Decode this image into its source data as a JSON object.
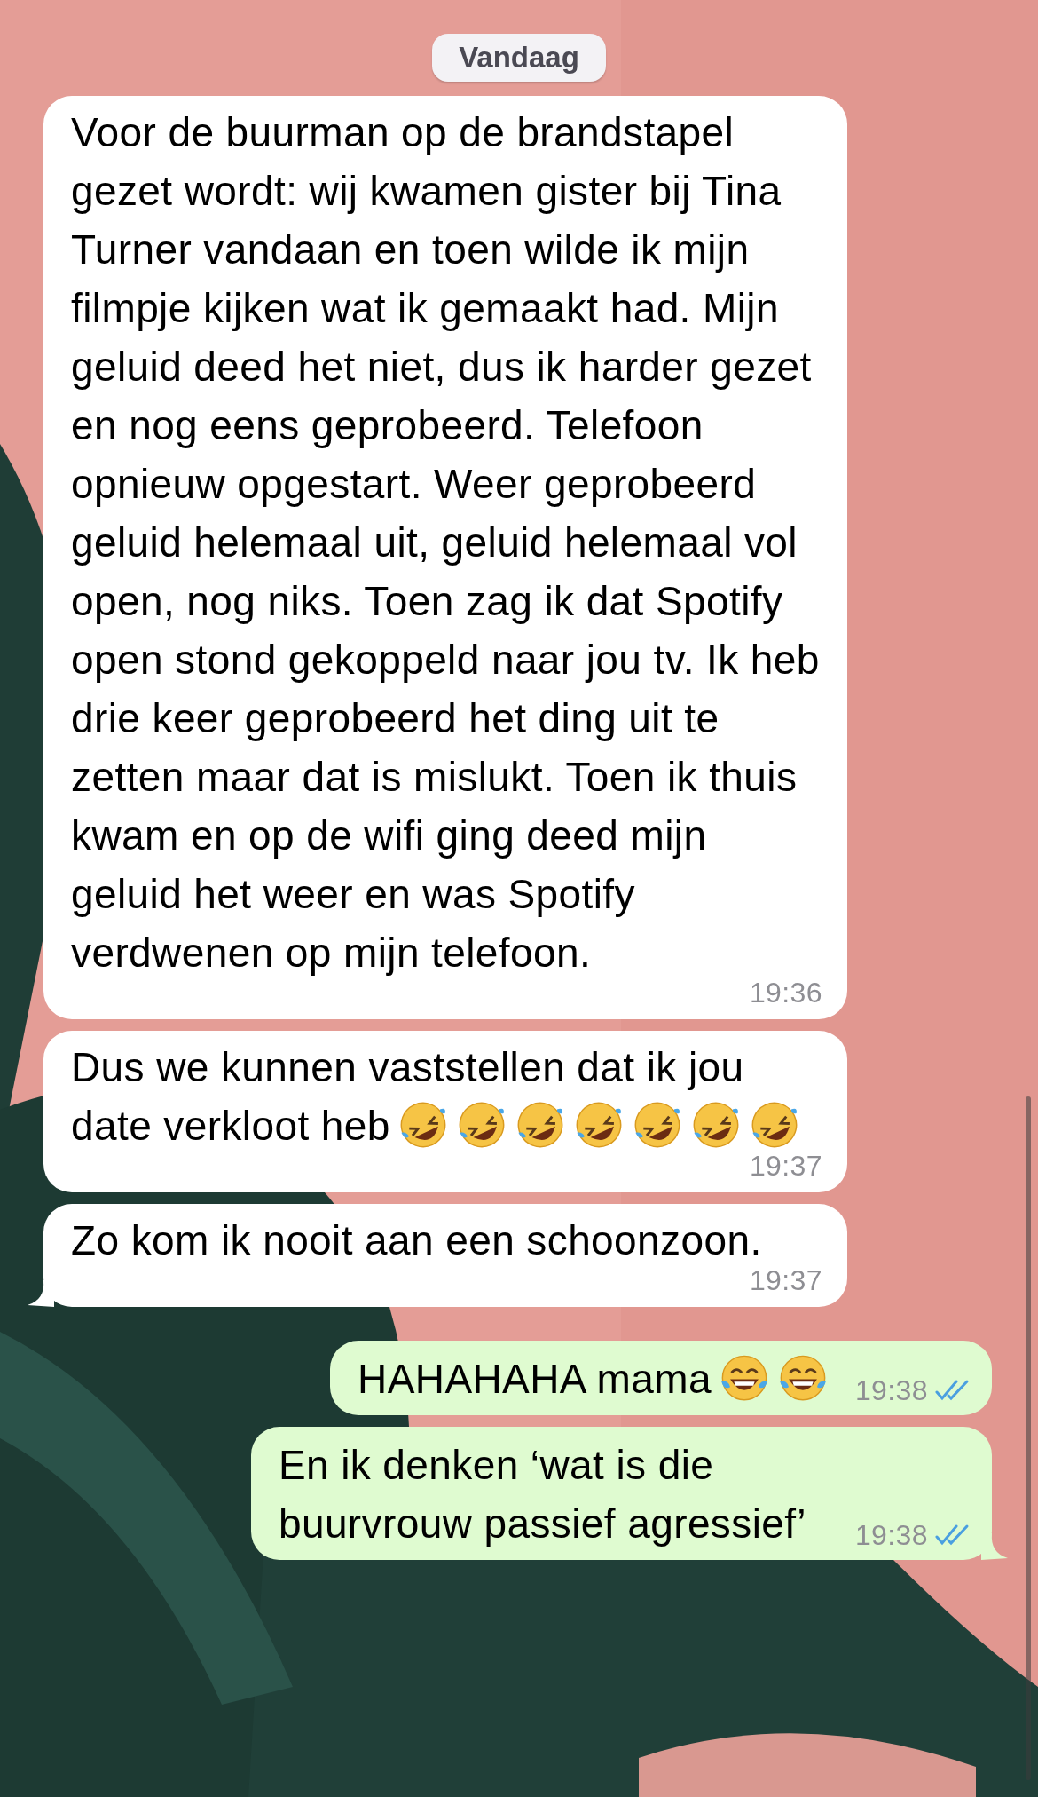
{
  "date_chip": "Vandaag",
  "messages": [
    {
      "kind": "received",
      "text": "Voor de buurman op de brandstapel gezet wordt: wij kwamen gister bij Tina Turner vandaan en toen wilde ik mijn filmpje kijken wat ik gemaakt had. Mijn geluid deed het niet, dus ik harder gezet en nog eens geprobeerd. Telefoon opnieuw opgestart. Weer geprobeerd geluid helemaal uit, geluid helemaal vol open, nog niks. Toen zag ik dat Spotify open stond gekoppeld naar jou tv. Ik heb drie keer geprobeerd het ding uit te zetten maar dat is mislukt. Toen ik thuis kwam en op de wifi ging deed mijn geluid het weer en was Spotify verdwenen op mijn telefoon.",
      "time": "19:36",
      "tail": false
    },
    {
      "kind": "received",
      "text": "Dus we kunnen vaststellen dat ik jou date verkloot heb",
      "emojis": [
        {
          "kind": "rofl"
        },
        {
          "kind": "rofl"
        },
        {
          "kind": "rofl"
        },
        {
          "kind": "rofl"
        },
        {
          "kind": "rofl"
        },
        {
          "kind": "rofl"
        },
        {
          "kind": "rofl"
        }
      ],
      "time": "19:37",
      "tail": false
    },
    {
      "kind": "received",
      "text": "Zo kom ik nooit aan een schoonzoon.",
      "time": "19:37",
      "tail": true
    },
    {
      "kind": "sent",
      "text": "HAHAHAHA mama",
      "emojis": [
        {
          "kind": "joy"
        },
        {
          "kind": "joy"
        }
      ],
      "time": "19:38",
      "read": true,
      "tail": false
    },
    {
      "kind": "sent",
      "text": "En ik denken ‘wat is die buurvrouw passief agressief’",
      "time": "19:38",
      "read": true,
      "tail": true
    }
  ]
}
